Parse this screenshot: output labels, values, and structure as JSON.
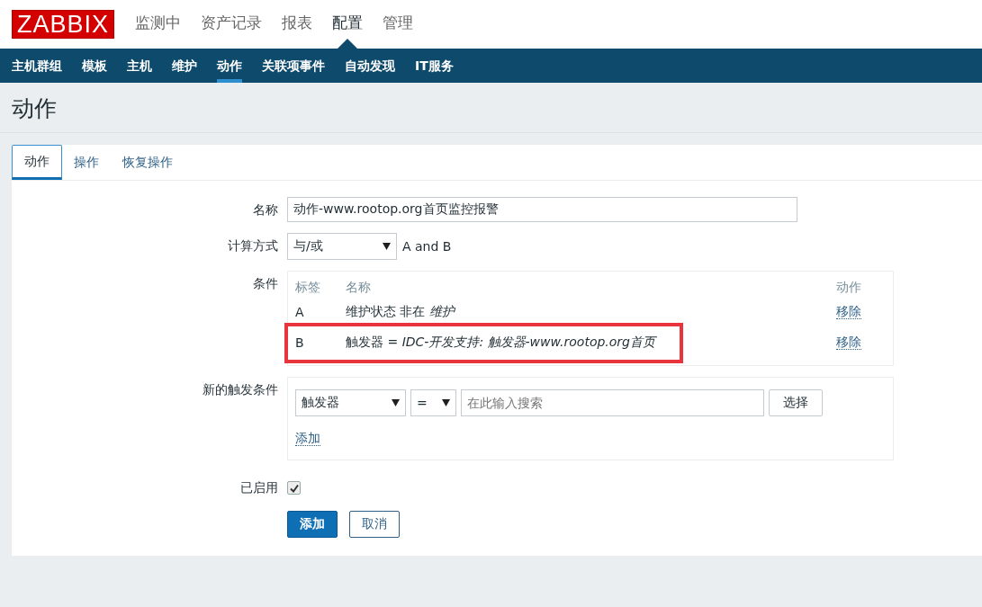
{
  "logo": "ZABBIX",
  "main_menu": [
    {
      "label": "监测中",
      "selected": false
    },
    {
      "label": "资产记录",
      "selected": false
    },
    {
      "label": "报表",
      "selected": false
    },
    {
      "label": "配置",
      "selected": true
    },
    {
      "label": "管理",
      "selected": false
    }
  ],
  "sub_menu": [
    {
      "label": "主机群组",
      "selected": false
    },
    {
      "label": "模板",
      "selected": false
    },
    {
      "label": "主机",
      "selected": false
    },
    {
      "label": "维护",
      "selected": false
    },
    {
      "label": "动作",
      "selected": true
    },
    {
      "label": "关联项事件",
      "selected": false
    },
    {
      "label": "自动发现",
      "selected": false
    },
    {
      "label": "IT服务",
      "selected": false
    }
  ],
  "page_title": "动作",
  "tabs": [
    {
      "label": "动作",
      "selected": true
    },
    {
      "label": "操作",
      "selected": false
    },
    {
      "label": "恢复操作",
      "selected": false
    }
  ],
  "form": {
    "name": {
      "label": "名称",
      "value": "动作-www.rootop.org首页监控报警"
    },
    "calculation": {
      "label": "计算方式",
      "value": "与/或",
      "formula": "A and B"
    },
    "conditions": {
      "label": "条件",
      "columns": [
        "标签",
        "名称",
        "动作"
      ],
      "rows": [
        {
          "tag": "A",
          "name": "维护状态 非在 *维护*",
          "action": "移除",
          "highlighted": false
        },
        {
          "tag": "B",
          "name": "触发器 = *IDC-开发支持: 触发器-www.rootop.org首页*",
          "action": "移除",
          "highlighted": true
        }
      ]
    },
    "new_condition": {
      "label": "新的触发条件",
      "type": "触发器",
      "operator": "=",
      "search": {
        "placeholder": "在此输入搜索"
      },
      "select_button": "选择",
      "add_link": "添加"
    },
    "enabled": {
      "label": "已启用",
      "checked": true
    },
    "buttons": [
      {
        "label": "添加",
        "kind": "primary"
      },
      {
        "label": "取消",
        "kind": "secondary"
      }
    ]
  }
}
